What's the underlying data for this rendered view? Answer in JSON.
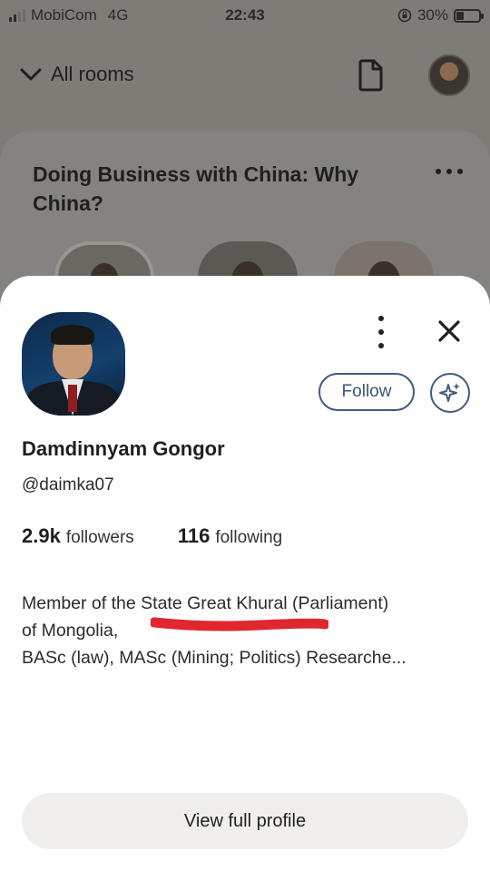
{
  "status_bar": {
    "carrier": "MobiCom",
    "network": "4G",
    "time": "22:43",
    "battery_percent": "30%",
    "battery_level": 0.3
  },
  "topnav": {
    "rooms_label": "All rooms",
    "doc_icon": "document-icon",
    "avatar_icon": "user-avatar"
  },
  "room": {
    "title": "Doing Business with China: Why China?"
  },
  "profile": {
    "name": "Damdinnyam Gongor",
    "handle": "@daimka07",
    "followers_count": "2.9k",
    "followers_label": "followers",
    "following_count": "116",
    "following_label": "following",
    "bio_lines": [
      "Member of the State Great Khural (Parliament)",
      "of Mongolia,",
      "BASc (law), MASc (Mining; Politics) Researche..."
    ],
    "follow_label": "Follow",
    "view_full_profile_label": "View full profile"
  },
  "colors": {
    "follow_border": "#3f5b80",
    "highlight_stroke": "#e0262e",
    "sheet_bg": "#ffffff",
    "button_bg": "#f0efed"
  }
}
